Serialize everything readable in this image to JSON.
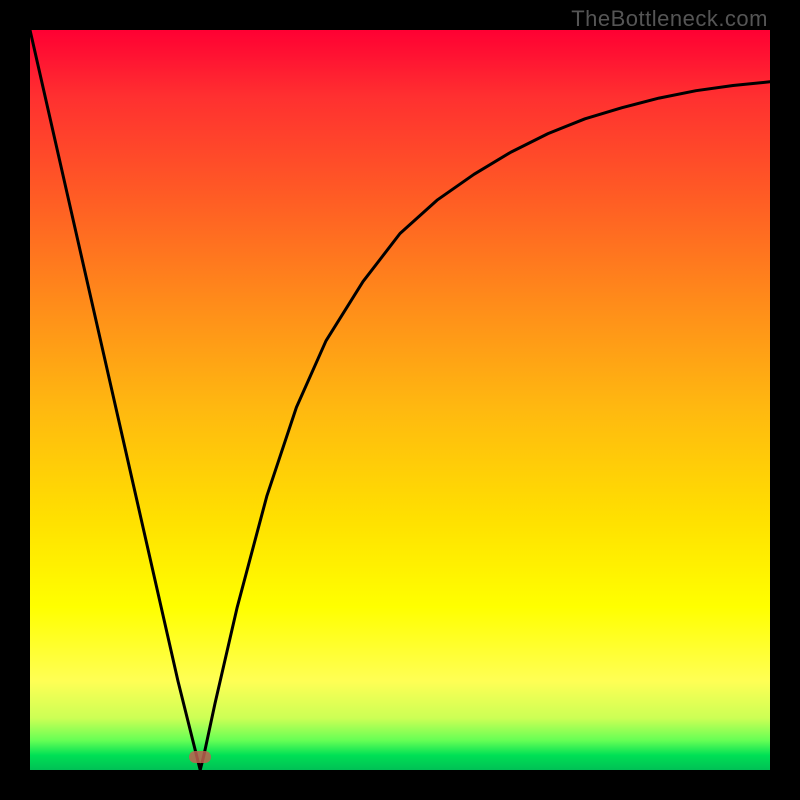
{
  "watermark": "TheBottleneck.com",
  "chart_data": {
    "type": "line",
    "title": "",
    "xlabel": "",
    "ylabel": "",
    "xlim": [
      0,
      1
    ],
    "ylim": [
      0,
      1
    ],
    "marker": {
      "x": 0.23,
      "y": 0.0
    },
    "series": [
      {
        "name": "curve",
        "x": [
          0.0,
          0.05,
          0.1,
          0.15,
          0.2,
          0.225,
          0.23,
          0.235,
          0.25,
          0.28,
          0.32,
          0.36,
          0.4,
          0.45,
          0.5,
          0.55,
          0.6,
          0.65,
          0.7,
          0.75,
          0.8,
          0.85,
          0.9,
          0.95,
          1.0
        ],
        "y": [
          1.0,
          0.78,
          0.56,
          0.34,
          0.12,
          0.02,
          0.0,
          0.02,
          0.09,
          0.22,
          0.37,
          0.49,
          0.58,
          0.66,
          0.725,
          0.77,
          0.805,
          0.835,
          0.86,
          0.88,
          0.895,
          0.908,
          0.918,
          0.925,
          0.93
        ]
      }
    ],
    "background_gradient": {
      "top": "#ff0033",
      "mid": "#ffe000",
      "bottom": "#00c055"
    }
  }
}
